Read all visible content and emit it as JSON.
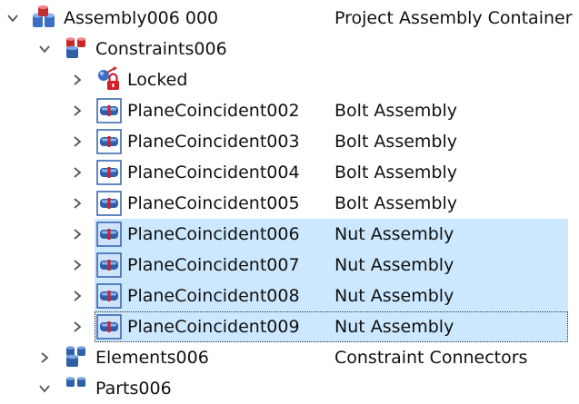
{
  "tree": {
    "root": {
      "label": "Assembly006 000",
      "description": "Project Assembly Container",
      "icon": "assembly-icon",
      "expanded": true
    },
    "constraints": {
      "label": "Constraints006",
      "description": "",
      "icon": "constraints-group-icon",
      "expanded": true
    },
    "locked": {
      "label": "Locked",
      "icon": "locked-constraint-icon"
    },
    "items": [
      {
        "label": "PlaneCoincident002",
        "description": "Bolt Assembly",
        "icon": "plane-coincident-icon",
        "selected": false
      },
      {
        "label": "PlaneCoincident003",
        "description": "Bolt Assembly",
        "icon": "plane-coincident-icon",
        "selected": false
      },
      {
        "label": "PlaneCoincident004",
        "description": "Bolt Assembly",
        "icon": "plane-coincident-icon",
        "selected": false
      },
      {
        "label": "PlaneCoincident005",
        "description": "Bolt Assembly",
        "icon": "plane-coincident-icon",
        "selected": false
      },
      {
        "label": "PlaneCoincident006",
        "description": "Nut Assembly",
        "icon": "plane-coincident-icon",
        "selected": true
      },
      {
        "label": "PlaneCoincident007",
        "description": "Nut Assembly",
        "icon": "plane-coincident-icon",
        "selected": true
      },
      {
        "label": "PlaneCoincident008",
        "description": "Nut Assembly",
        "icon": "plane-coincident-icon",
        "selected": true
      },
      {
        "label": "PlaneCoincident009",
        "description": "Nut Assembly",
        "icon": "plane-coincident-icon",
        "selected": true
      }
    ],
    "elements": {
      "label": "Elements006",
      "description": "Constraint Connectors",
      "icon": "elements-group-icon",
      "expanded": false
    },
    "parts": {
      "label": "Parts006",
      "icon": "parts-group-icon",
      "expanded": true
    }
  },
  "colors": {
    "selection": "#cce8ff",
    "accent": "#2f5fa8",
    "constraint_red": "#d0202a"
  }
}
